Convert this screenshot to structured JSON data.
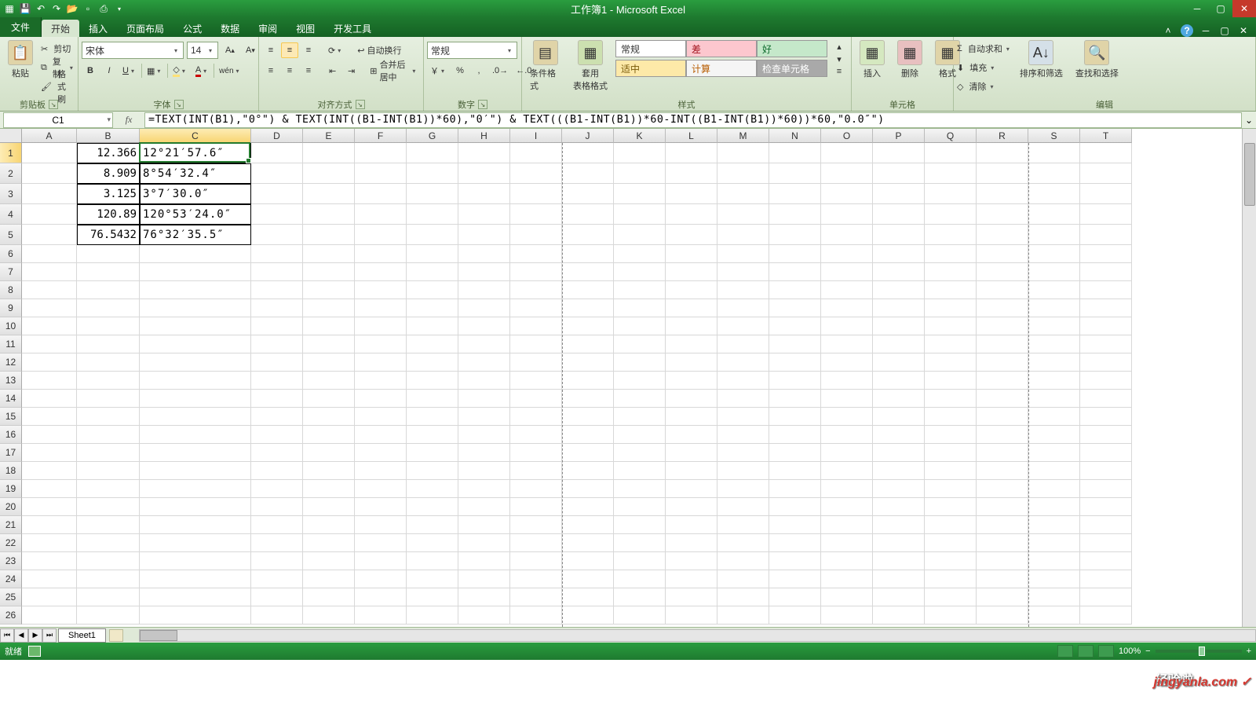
{
  "title": "工作簿1 - Microsoft Excel",
  "tabs": {
    "file": "文件",
    "home": "开始",
    "insert": "插入",
    "layout": "页面布局",
    "formulas": "公式",
    "data": "数据",
    "review": "审阅",
    "view": "视图",
    "dev": "开发工具"
  },
  "clipboard": {
    "paste": "粘贴",
    "cut": "剪切",
    "copy": "复制",
    "painter": "格式刷",
    "label": "剪贴板"
  },
  "font": {
    "name": "宋体",
    "size": "14",
    "label": "字体"
  },
  "align": {
    "wrap": "自动换行",
    "merge": "合并后居中",
    "label": "对齐方式"
  },
  "number": {
    "fmt": "常规",
    "label": "数字"
  },
  "stylesgrp": {
    "cond": "条件格式",
    "tbl": "套用\n表格格式",
    "normal": "常规",
    "bad": "差",
    "good": "好",
    "neutral": "适中",
    "calc": "计算",
    "check": "检查单元格",
    "label": "样式"
  },
  "cells": {
    "insert": "插入",
    "delete": "删除",
    "format": "格式",
    "label": "单元格"
  },
  "edit": {
    "sum": "自动求和",
    "fill": "填充",
    "clear": "清除",
    "sort": "排序和筛选",
    "find": "查找和选择",
    "label": "编辑"
  },
  "namebox": "C1",
  "formula": "=TEXT(INT(B1),\"0°\") & TEXT(INT((B1-INT(B1))*60),\"0′\") & TEXT(((B1-INT(B1))*60-INT((B1-INT(B1))*60))*60,\"0.0″\")",
  "cols": [
    "A",
    "B",
    "C",
    "D",
    "E",
    "F",
    "G",
    "H",
    "I",
    "J",
    "K",
    "L",
    "M",
    "N",
    "O",
    "P",
    "Q",
    "R",
    "S",
    "T"
  ],
  "rows": [
    "1",
    "2",
    "3",
    "4",
    "5",
    "6",
    "7",
    "8",
    "9",
    "10",
    "11",
    "12",
    "13",
    "14",
    "15",
    "16",
    "17",
    "18",
    "19",
    "20",
    "21",
    "22",
    "23",
    "24",
    "25",
    "26"
  ],
  "dataB": [
    "12.366",
    "8.909",
    "3.125",
    "120.89",
    "76.5432"
  ],
  "dataC": [
    "12°21′57.6″",
    "8°54′32.4″",
    "3°7′30.0″",
    "120°53′24.0″",
    "76°32′35.5″"
  ],
  "sheet": "Sheet1",
  "status": "就绪",
  "zoom": "100%",
  "watermark": "jingyanla.com",
  "watermark_label": "经验啦"
}
